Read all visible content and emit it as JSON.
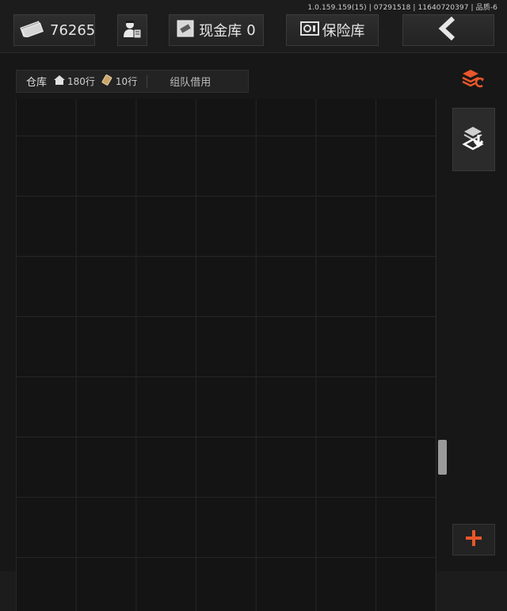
{
  "version": "1.0.159.159(15) | 07291518 | 11640720397 | 品质-6",
  "topbar": {
    "money_value": "76265",
    "cash_vault_label": "现金库",
    "cash_vault_value": "0",
    "safe_label": "保险库"
  },
  "tabs": {
    "warehouse_label": "仓库",
    "home_rows": "180行",
    "extra_rows": "10行",
    "team_borrow_label": "组队借用"
  },
  "colors": {
    "accent": "#e8572a",
    "background": "#171717",
    "button": "#2a2a2a"
  },
  "icons": [
    "money-icon",
    "agent-icon",
    "cash-vault-icon",
    "safe-icon",
    "back-arrow-icon",
    "home-icon",
    "ticket-icon",
    "sort-icon",
    "import-icon",
    "plus-icon"
  ]
}
